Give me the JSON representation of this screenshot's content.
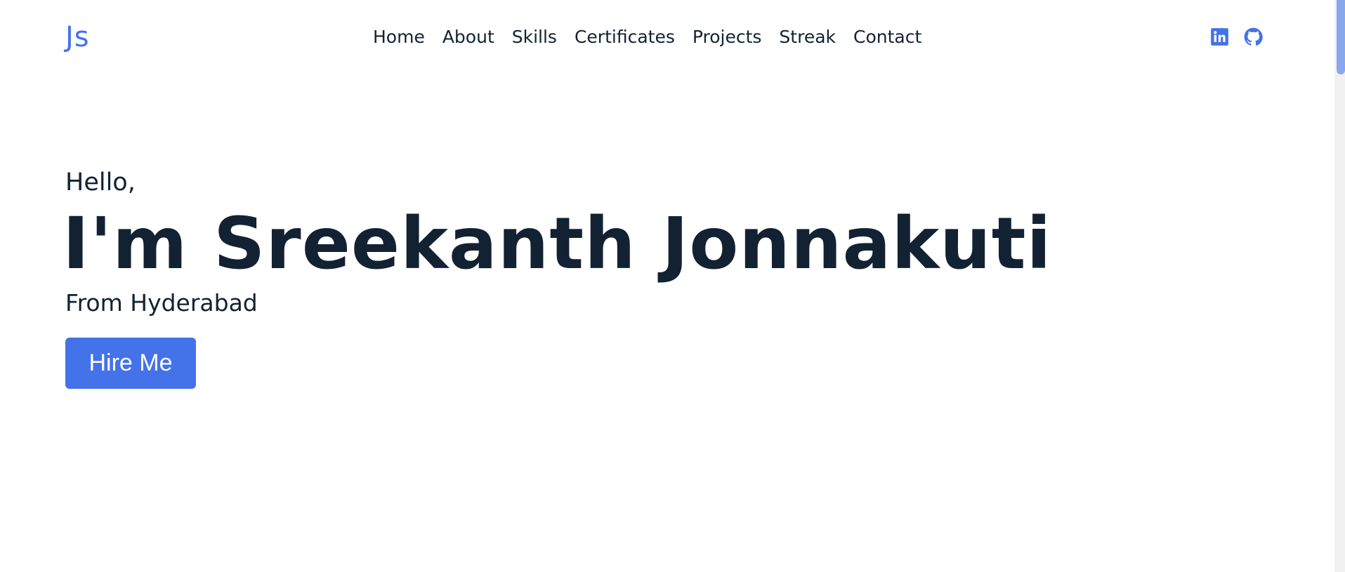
{
  "header": {
    "logo": "Js",
    "nav": [
      "Home",
      "About",
      "Skills",
      "Certificates",
      "Projects",
      "Streak",
      "Contact"
    ],
    "social_icons": [
      "linkedin-icon",
      "github-icon"
    ]
  },
  "hero": {
    "greeting": "Hello,",
    "name": "I'm Sreekanth Jonnakuti",
    "location": "From Hyderabad",
    "cta_label": "Hire Me"
  },
  "colors": {
    "accent": "#4472e8",
    "text": "#122233",
    "background": "#ffffff"
  }
}
